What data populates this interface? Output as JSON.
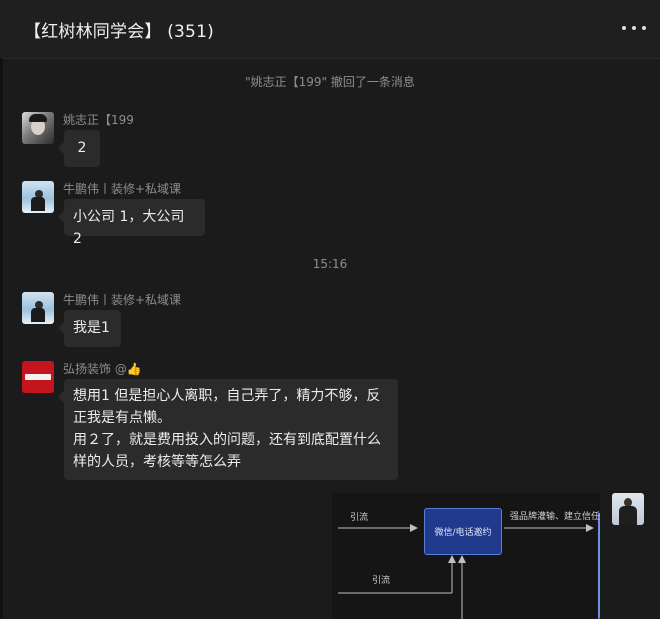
{
  "header": {
    "title": "【红树林同学会】 (351)",
    "more_icon": "more-horizontal-icon"
  },
  "system_message": "\"姚志正【199\" 撤回了一条消息",
  "time_divider": "15:16",
  "messages": [
    {
      "sender": "姚志正【199",
      "lines": [
        "2"
      ]
    },
    {
      "sender": "牛鹏伟丨装修+私域课",
      "lines": [
        "小公司 1，大公司 2"
      ]
    },
    {
      "sender": "牛鹏伟丨装修+私域课",
      "lines": [
        "我是1"
      ]
    },
    {
      "sender": "弘扬装饰 @",
      "sender_emoji": "👍",
      "lines": [
        "想用1 但是担心人离职，自己弄了，精力不够，反",
        "正我是有点懒。",
        "用２了，就是费用投入的问题，还有到底配置什么",
        "样的人员，考核等等怎么弄"
      ]
    }
  ],
  "image_message": {
    "labels": {
      "flow1": "引流",
      "box": "微信/电话邀约",
      "right": "强品牌灌输、建立信任",
      "flow2": "引流"
    }
  },
  "colors": {
    "background": "#1b1b1b",
    "bubble": "#2b2b2b",
    "muted_text": "#8d8d8d",
    "diagram_box": "#1f3a8a"
  }
}
